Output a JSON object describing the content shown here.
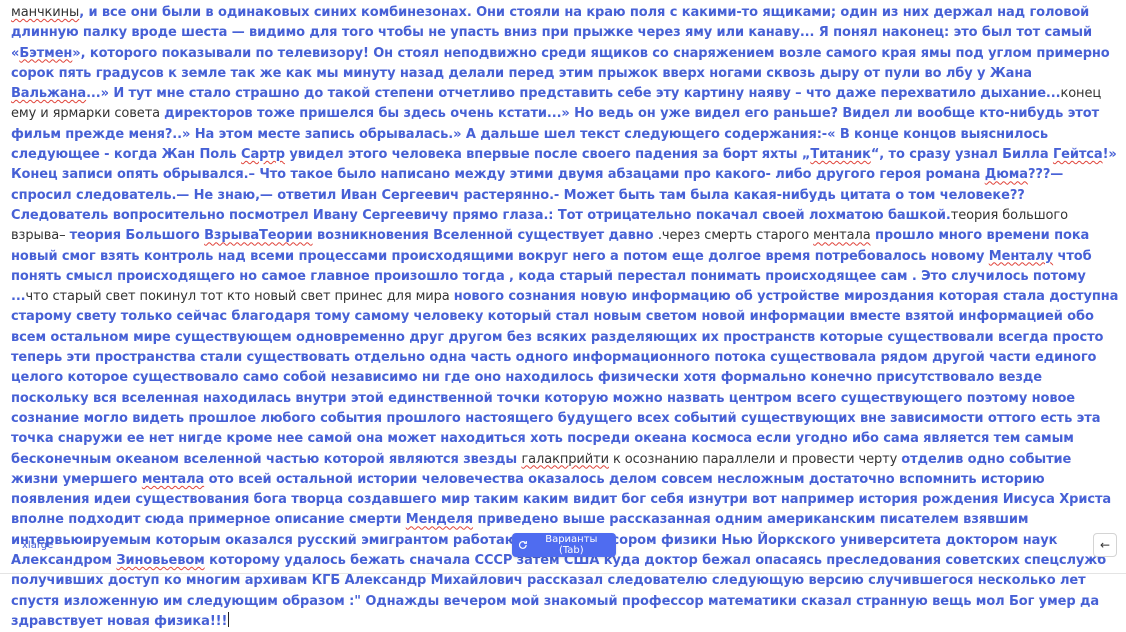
{
  "editor": {
    "segments": [
      {
        "text": "манчкины",
        "style": "p",
        "spell": true
      },
      {
        "text": ", и все они были в одинаковых синих комбинезонах. Они стояли на краю поля с какими-то ящиками; один из них держал над головой длинную палку вроде шеста — видимо для того чтобы не упасть вниз при прыжке через яму или канаву... Я понял наконец: это был тот самый «",
        "style": "b"
      },
      {
        "text": "Бэтмен",
        "style": "b",
        "spell": true
      },
      {
        "text": "», которого показывали по телевизору! Он стоял неподвижно среди ящиков со снаряжением возле самого края ямы под углом примерно сорок пять градусов к земле так же как мы минуту назад делали перед этим прыжок вверх ногами сквозь дыру от пули во лбу у Жана ",
        "style": "b"
      },
      {
        "text": "Вальжана",
        "style": "b",
        "spell": true
      },
      {
        "text": "...» И тут мне стало страшно до такой степени отчетливо представить себе эту картину наяву – что даже перехватило дыхание...",
        "style": "b"
      },
      {
        "text": "конец ему и ярмарки совета ",
        "style": "p"
      },
      {
        "text": "директоров тоже пришелся бы здесь очень кстати...» Но ведь он уже видел его раньше? Видел ли вообще кто-нибудь этот фильм прежде меня?..» На этом месте запись обрывалась.» А дальше шел текст следующего содержания:-« В конце концов выяснилось следующее - когда Жан Поль ",
        "style": "b"
      },
      {
        "text": "Сартр",
        "style": "b",
        "spell": true
      },
      {
        "text": " увидел этого человека впервые после своего падения за борт яхты „",
        "style": "b"
      },
      {
        "text": "Титаник",
        "style": "b",
        "spell": true
      },
      {
        "text": "“, то сразу узнал Билла ",
        "style": "b"
      },
      {
        "text": "Гейтса",
        "style": "b",
        "spell": true
      },
      {
        "text": "!» Конец записи опять обрывался.– Что такое было написано между этими двумя абзацами про какого- либо другого героя романа ",
        "style": "b"
      },
      {
        "text": "Дюма",
        "style": "b",
        "spell": true
      },
      {
        "text": "???— спросил следователь.— Не знаю,— ответил Иван Сергеевич растерянно.- Может быть там была какая-нибудь цитата о том человеке?? Следователь вопросительно посмотрел Ивану Сергеевичу прямо глаза.: Тот отрицательно покачал своей лохматою башкой.",
        "style": "b"
      },
      {
        "text": "теория большого взрыва– ",
        "style": "p"
      },
      {
        "text": "теория Большого ",
        "style": "b"
      },
      {
        "text": "ВзрываТеории",
        "style": "b",
        "spell": true
      },
      {
        "text": " возникновения Вселенной существует давно ",
        "style": "b"
      },
      {
        "text": ".через смерть старого ",
        "style": "p"
      },
      {
        "text": "ментала",
        "style": "p",
        "spell": true
      },
      {
        "text": " прошло много времени пока новый смог взять контроль над всеми процессами происходящими вокруг него а потом еще долгое время потребовалось новому ",
        "style": "b"
      },
      {
        "text": "Менталу",
        "style": "b",
        "spell": true
      },
      {
        "text": " чтоб понять смысл происходящего но самое главное произошло тогда , кода старый перестал понимать происходящее сам . Это случилось потому ...",
        "style": "b"
      },
      {
        "text": "что старый свет покинул тот кто новый свет принес для мира ",
        "style": "p"
      },
      {
        "text": "нового сознания новую информацию об устройстве мироздания которая стала доступна старому свету только сейчас благодаря тому самому человеку который стал новым светом новой информации вместе взятой информацией обо всем остальном мире существующем одновременно друг другом без всяких разделяющих их пространств которые существовали всегда просто теперь эти пространства стали существовать отдельно одна часть одного информационного потока существовала рядом другой части единого целого которое существовало само собой независимо ни где оно находилось физически хотя формально конечно присутствовало везде поскольку вся вселенная находилась внутри этой единственной точки которую можно назвать центром всего существующего поэтому новое сознание могло видеть прошлое любого события прошлого настоящего будущего всех событий существующих вне зависимости оттого есть эта точка снаружи ее нет нигде кроме нее самой она может находиться хоть посреди океана космоса если угодно ибо сама является тем самым бесконечным океаном вселенной частью которой являются звезды ",
        "style": "b"
      },
      {
        "text": "галакприйти",
        "style": "p",
        "spell": true
      },
      {
        "text": " к осознанию параллели и провести черту ",
        "style": "p"
      },
      {
        "text": "отделив одно событие жизни умершего ",
        "style": "b"
      },
      {
        "text": "ментала",
        "style": "b",
        "spell": true
      },
      {
        "text": " ото всей остальной истории человечества оказалось делом совсем несложным достаточно вспомнить историю появления идеи существования бога творца создавшего мир таким каким видит бог себя изнутри вот например история рождения Иисуса Христа вполне подходит сюда примерное описание смерти ",
        "style": "b"
      },
      {
        "text": "Менделя",
        "style": "b",
        "spell": true
      },
      {
        "text": " приведено выше рассказанная одним американским писателем взявшим интервьюируемым которым оказался русский эмигрантом работающим профессором физики Нью Йоркского университета доктором наук Александром ",
        "style": "b"
      },
      {
        "text": "Зиновьевом",
        "style": "b",
        "spell": true
      },
      {
        "text": " которому удалось бежать сначала СССР затем США куда доктор бежал опасаясь преследования советских спецслужб получивших доступ ко многим архивам КГБ Александр Михайлович рассказал следователю следующую версию случившегося несколько лет спустя изложенную им следующим образом :\" Однажды вечером мой знакомый профессор математики сказал странную вещь мол Бог умер да здравствует новая физика!!!",
        "style": "b"
      }
    ]
  },
  "footer": {
    "model_label": "xlarge",
    "variants_label": "Варианты (Tab)",
    "back_icon": "←"
  },
  "colors": {
    "accent": "#4761d6",
    "button": "#4f6cf0",
    "plain_text": "#333333",
    "spell_underline": "#e0433a"
  }
}
